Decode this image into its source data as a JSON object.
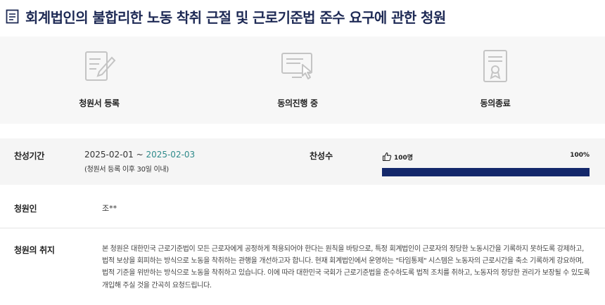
{
  "header": {
    "icon": "document-list-icon",
    "title": "회계법인의 불합리한 노동 착취 근절 및 근로기준법 준수 요구에 관한 청원"
  },
  "steps": [
    {
      "icon": "document-edit-icon",
      "label": "청원서 등록"
    },
    {
      "icon": "monitor-click-icon",
      "label": "동의진행 중"
    },
    {
      "icon": "certificate-icon",
      "label": "동의종료"
    }
  ],
  "period": {
    "label": "찬성기간",
    "start": "2025-02-01",
    "separator": " ~ ",
    "end": "2025-02-03",
    "note": "(청원서 등록 이후 30일 이내)"
  },
  "support": {
    "label": "찬성수",
    "icon": "thumbs-up-icon",
    "count": "100명",
    "percent_text": "100%",
    "progress": 1.0
  },
  "author": {
    "label": "청원인",
    "name": "조**"
  },
  "purpose": {
    "label": "청원의 취지",
    "text": "본 청원은 대한민국 근로기준법이 모든 근로자에게 공정하게 적용되어야 한다는 원칙을 바탕으로, 특정 회계법인이 근로자의 정당한 노동시간을 기록하지 못하도록 강제하고, 법적 보상을 회피하는 방식으로 노동을 착취하는 관행을 개선하고자 합니다. 현재 회계법인에서 운영하는 \"타임통제\" 시스템은 노동자의 근로시간을 축소 기록하게 강요하며, 법적 기준을 위반하는 방식으로 노동을 착취하고 있습니다. 이에 따라 대한민국 국회가 근로기준법을 준수하도록 법적 조치를 취하고, 노동자의 정당한 권리가 보장될 수 있도록 개입해 주실 것을 간곡히 요청드립니다."
  },
  "colors": {
    "title": "#1e2a55",
    "accent_date": "#2e8a8a",
    "progress_fill": "#14286b",
    "progress_track": "#d9dce4",
    "band_bg": "#f7f7f7",
    "icon_gray": "#c4c4c4"
  }
}
